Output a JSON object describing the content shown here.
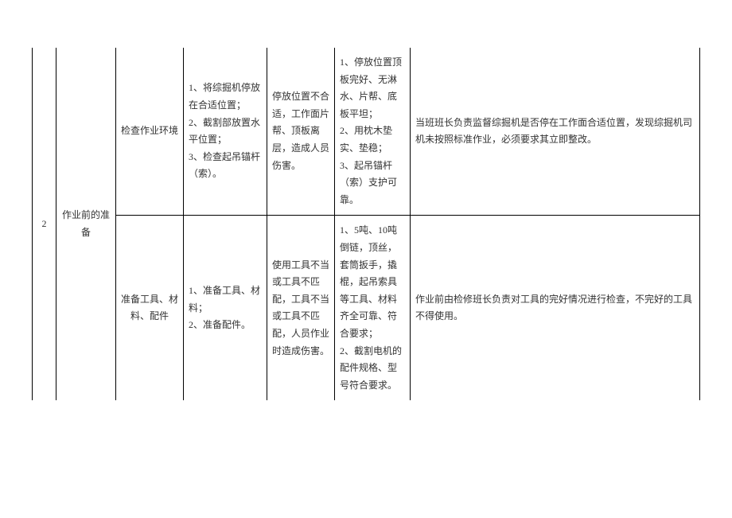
{
  "row_number": "2",
  "phase": "作业前的准备",
  "rows": [
    {
      "step": "检查作业环境",
      "content": "1、将综掘机停放在合适位置；\n2、截割部放置水平位置；\n3、检查起吊锚杆（索）。",
      "risk": "停放位置不合适，工作面片帮、顶板离层，造成人员伤害。",
      "measure": "1、停放位置顶板完好、无淋水、片帮、底板平坦；\n2、用枕木垫实、垫稳；\n3、起吊锚杆（索）支护可靠。",
      "note": "当班班长负责监督综掘机是否停在工作面合适位置，发现综掘机司机未按照标准作业，必须要求其立即整改。"
    },
    {
      "step": "准备工具、材料、配件",
      "content": "1、准备工具、材料；\n2、准备配件。",
      "risk": "使用工具不当或工具不匹配，工具不当或工具不匹配，人员作业时造成伤害。",
      "measure": "1、5吨、10吨倒链，顶丝，套筒扳手，撬棍，起吊索具等工具、材料齐全可靠、符合要求；\n2、截割电机的配件规格、型号符合要求。",
      "note": "作业前由检修班长负责对工具的完好情况进行检查，不完好的工具不得使用。"
    }
  ]
}
